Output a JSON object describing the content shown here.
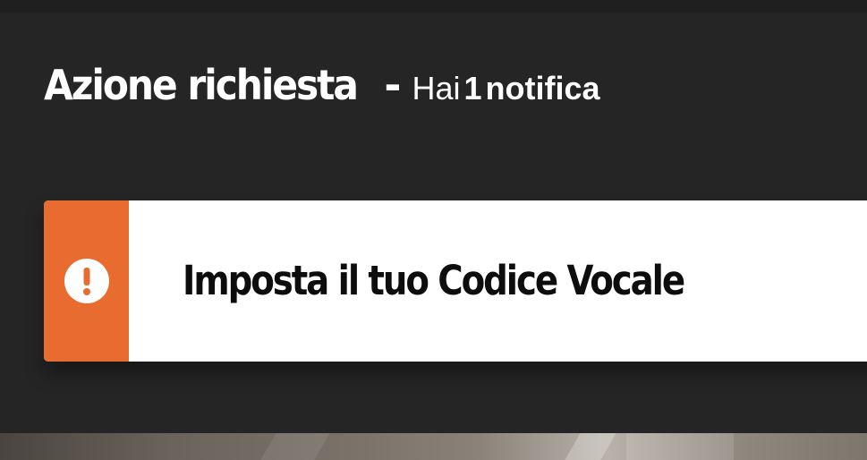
{
  "header": {
    "title": "Azione richiesta",
    "separator": "-",
    "subtitle_prefix": "Hai",
    "count": "1",
    "subtitle_suffix": "notifica"
  },
  "notification": {
    "label": "Imposta il tuo Codice Vocale",
    "icon": "exclamation-circle-icon",
    "accent_color": "#e86c2f"
  },
  "colors": {
    "background": "#252525",
    "card": "#ffffff",
    "accent": "#e86c2f"
  }
}
